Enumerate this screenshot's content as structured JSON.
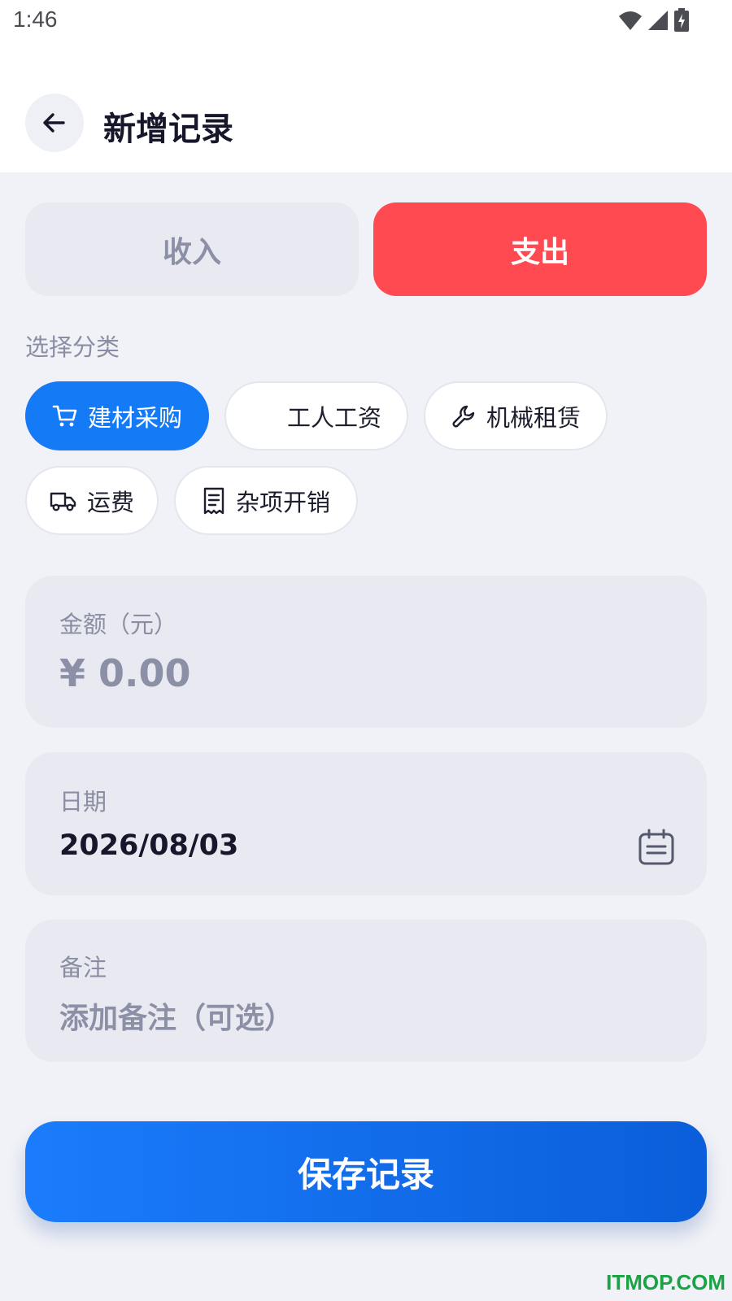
{
  "status_bar": {
    "time": "1:46",
    "icons": [
      "wifi-icon",
      "signal-icon",
      "battery-charging-icon"
    ]
  },
  "header": {
    "back_icon": "arrow-left-icon",
    "title": "新增记录"
  },
  "type_toggle": {
    "income_label": "收入",
    "expense_label": "支出",
    "selected": "expense",
    "colors": {
      "expense_active": "#ff4a52",
      "inactive": "#e9eaf1"
    }
  },
  "category": {
    "section_label": "选择分类",
    "selected": "建材采购",
    "items": [
      {
        "label": "建材采购",
        "icon": "cart-icon"
      },
      {
        "label": "工人工资",
        "icon": ""
      },
      {
        "label": "机械租赁",
        "icon": "wrench-icon"
      },
      {
        "label": "运费",
        "icon": "truck-icon"
      },
      {
        "label": "杂项开销",
        "icon": "receipt-icon"
      }
    ],
    "accent_color": "#157af5"
  },
  "amount": {
    "label": "金额（元）",
    "placeholder": "¥ 0.00"
  },
  "date": {
    "label": "日期",
    "value": "2026/08/03",
    "icon": "calendar-icon"
  },
  "note": {
    "label": "备注",
    "placeholder": "添加备注（可选）"
  },
  "save_button": {
    "label": "保存记录",
    "color": "#157af5"
  },
  "watermark": "ITMOP.COM"
}
